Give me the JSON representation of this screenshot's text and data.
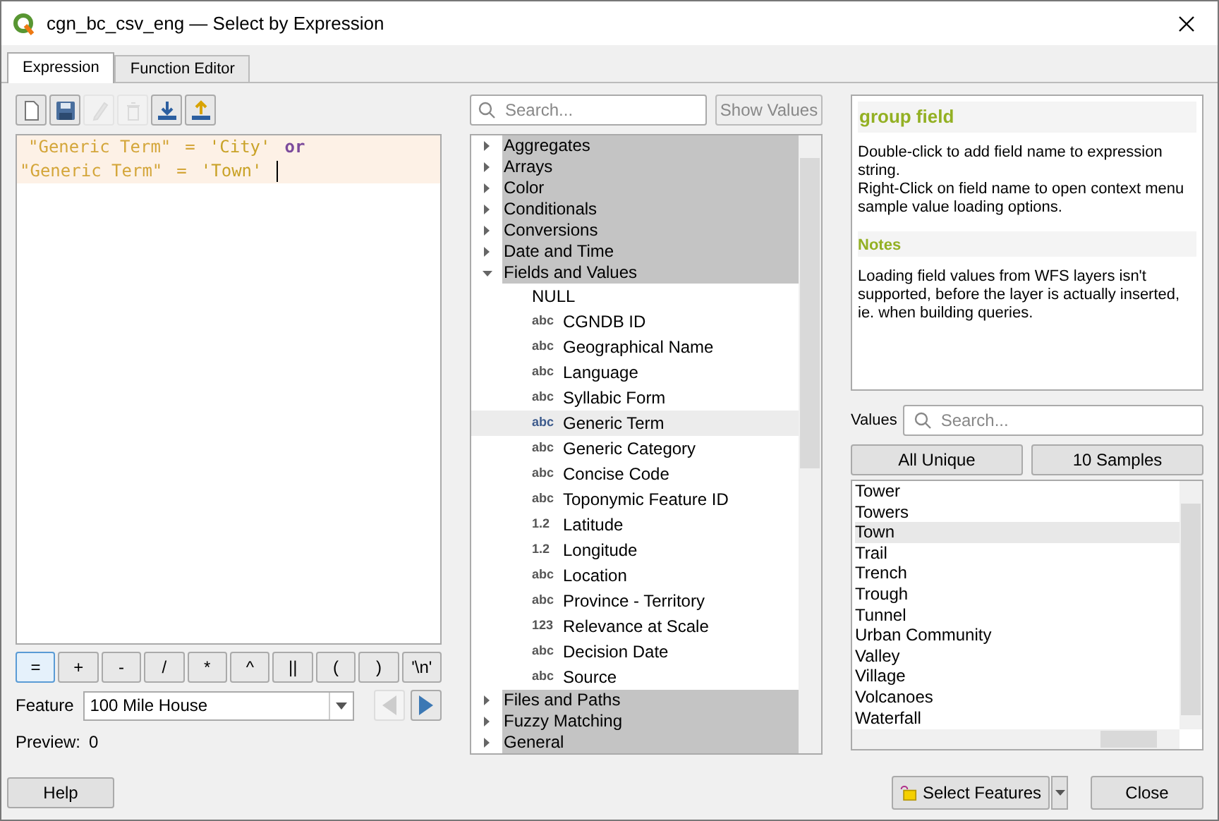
{
  "window": {
    "title": "cgn_bc_csv_eng — Select by Expression"
  },
  "tabs": [
    {
      "label": "Expression",
      "selected": true
    },
    {
      "label": "Function Editor",
      "selected": false
    }
  ],
  "toolbar": [
    {
      "kind": "new",
      "disabled": false
    },
    {
      "kind": "save",
      "disabled": false
    },
    {
      "kind": "edit",
      "disabled": true
    },
    {
      "kind": "delete",
      "disabled": true
    },
    {
      "kind": "import",
      "disabled": false
    },
    {
      "kind": "export",
      "disabled": false
    }
  ],
  "expression": [
    [
      {
        "text": "\"Generic Term\"",
        "kind": "field"
      },
      {
        "text": "=",
        "kind": "operator"
      },
      {
        "text": "'City'",
        "kind": "string"
      },
      {
        "text": "or",
        "kind": "keyword"
      }
    ],
    [
      {
        "text": "\"Generic Term\"",
        "kind": "field"
      },
      {
        "text": "=",
        "kind": "operator"
      },
      {
        "text": "'Town'",
        "kind": "string"
      }
    ]
  ],
  "operators": [
    {
      "label": "=",
      "selected": true
    },
    {
      "label": "+",
      "selected": false
    },
    {
      "label": "-",
      "selected": false
    },
    {
      "label": "/",
      "selected": false
    },
    {
      "label": "*",
      "selected": false
    },
    {
      "label": "^",
      "selected": false
    },
    {
      "label": "||",
      "selected": false
    },
    {
      "label": "(",
      "selected": false
    },
    {
      "label": ")",
      "selected": false
    },
    {
      "label": "'\\n'",
      "selected": false
    }
  ],
  "feature": {
    "label": "Feature",
    "value": "100 Mile House",
    "prev_disabled": true,
    "next_disabled": false
  },
  "preview": {
    "label": "Preview:",
    "value": "0"
  },
  "search": {
    "placeholder": "Search...",
    "button": "Show Values"
  },
  "tree": [
    {
      "label": "Aggregates",
      "expanded": false
    },
    {
      "label": "Arrays",
      "expanded": false
    },
    {
      "label": "Color",
      "expanded": false
    },
    {
      "label": "Conditionals",
      "expanded": false
    },
    {
      "label": "Conversions",
      "expanded": false
    },
    {
      "label": "Date and Time",
      "expanded": false
    },
    {
      "label": "Fields and Values",
      "expanded": true,
      "children": [
        {
          "label": "NULL",
          "selected": false
        },
        {
          "type": "abc",
          "label": "CGNDB ID",
          "selected": false
        },
        {
          "type": "abc",
          "label": "Geographical Name",
          "selected": false
        },
        {
          "type": "abc",
          "label": "Language",
          "selected": false
        },
        {
          "type": "abc",
          "label": "Syllabic Form",
          "selected": false
        },
        {
          "type": "abc",
          "label": "Generic Term",
          "selected": true
        },
        {
          "type": "abc",
          "label": "Generic Category",
          "selected": false
        },
        {
          "type": "abc",
          "label": "Concise Code",
          "selected": false
        },
        {
          "type": "abc",
          "label": "Toponymic Feature ID",
          "selected": false
        },
        {
          "type": "1.2",
          "label": "Latitude",
          "selected": false
        },
        {
          "type": "1.2",
          "label": "Longitude",
          "selected": false
        },
        {
          "type": "abc",
          "label": "Location",
          "selected": false
        },
        {
          "type": "abc",
          "label": "Province - Territory",
          "selected": false
        },
        {
          "type": "123",
          "label": "Relevance at Scale",
          "selected": false
        },
        {
          "type": "abc",
          "label": "Decision Date",
          "selected": false
        },
        {
          "type": "abc",
          "label": "Source",
          "selected": false
        }
      ]
    },
    {
      "label": "Files and Paths",
      "expanded": false
    },
    {
      "label": "Fuzzy Matching",
      "expanded": false
    },
    {
      "label": "General",
      "expanded": false
    }
  ],
  "help": {
    "title": "group field",
    "body": [
      "Double-click to add field name to expression string.",
      "Right-Click on field name to open context menu sample value loading options."
    ],
    "notes_title": "Notes",
    "notes": "Loading field values from WFS layers isn't supported, before the layer is actually inserted, ie. when building queries."
  },
  "values": {
    "label": "Values",
    "placeholder": "Search...",
    "buttons": [
      "All Unique",
      "10 Samples"
    ],
    "items": [
      {
        "label": "Tower",
        "selected": false
      },
      {
        "label": "Towers",
        "selected": false
      },
      {
        "label": "Town",
        "selected": true
      },
      {
        "label": "Trail",
        "selected": false
      },
      {
        "label": "Trench",
        "selected": false
      },
      {
        "label": "Trough",
        "selected": false
      },
      {
        "label": "Tunnel",
        "selected": false
      },
      {
        "label": "Urban Community",
        "selected": false
      },
      {
        "label": "Valley",
        "selected": false
      },
      {
        "label": "Village",
        "selected": false
      },
      {
        "label": "Volcanoes",
        "selected": false
      },
      {
        "label": "Waterfall",
        "selected": false
      }
    ]
  },
  "buttons": {
    "help": "Help",
    "select": "Select Features",
    "close": "Close"
  }
}
